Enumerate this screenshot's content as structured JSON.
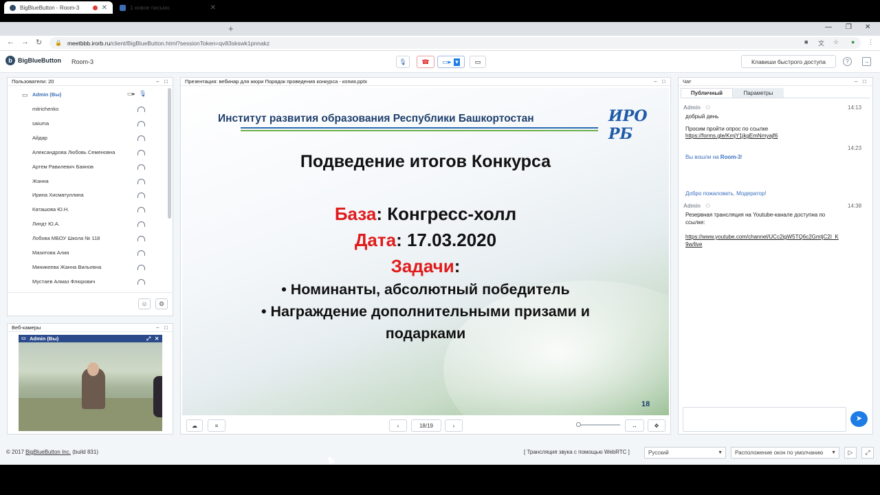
{
  "browser": {
    "tabs": [
      {
        "title": "BigBlueButton - Room-3",
        "active": true
      },
      {
        "title": "1 новое письмо",
        "active": false
      }
    ],
    "url_host": "meetbbb.irorb.ru",
    "url_path": "/client/BigBlueButton.html?sessionToken=qv83skswk1pnnakz"
  },
  "app": {
    "brand": "BigBlueButton",
    "room": "Room-3",
    "hotkeys_label": "Клавиши быстрого доступа"
  },
  "users": {
    "title": "Пользователи: 20",
    "me": "Admin (Вы)",
    "list": [
      "mitrichenko",
      "saiuma",
      "Айдар",
      "Александрова Любовь Семеновна",
      "Артем Равилевич Баянов",
      "Жанна",
      "Ирина Хисматуллина",
      "Каташова Ю.Н.",
      "Линдт Ю.А.",
      "Лобова МБОУ Школа № 118",
      "Мазитова Алия",
      "Миникеева Жанна Вильевна",
      "Мустаев Алмаз Флюрович"
    ]
  },
  "webcams": {
    "title": "Веб-камеры",
    "stream_label": "Admin (Вы)"
  },
  "presentation": {
    "title": "Презентация: вебинар для жюри Порядок проведения конкурса - копия.pptx",
    "page_indicator": "18/19",
    "slide": {
      "header": "Институт развития образования Республики Башкортостан",
      "logo_text": "ИРО РБ",
      "heading": "Подведение итогов Конкурса",
      "base_label": "База",
      "base_value": ": Конгресс-холл",
      "date_label": "Дата",
      "date_value": ": 17.03.2020",
      "tasks_label": "Задачи",
      "tasks_colon": ":",
      "bullet1": "• Номинанты, абсолютный победитель",
      "bullet2": "• Награждение дополнительными призами и",
      "bullet2_cont": "подарками",
      "page_number": "18"
    }
  },
  "chat": {
    "title": "Чат",
    "tab_public": "Публичный",
    "tab_options": "Параметры",
    "messages": {
      "m1_name": "Admin",
      "m1_time": "14:13",
      "m1_l1": "добрый день",
      "m1_l2": "Просим пройти опрос по ссылке",
      "m1_link": "https://forms.gle/KmjY1jkgEmNmyajf6",
      "m2_time": "14:23",
      "m2_text_pre": "Вы вошли на ",
      "m2_text_room": "Room-3",
      "m2_text_post": "!",
      "m3_text": "Добро пожаловать, Модератор!",
      "m4_name": "Admin",
      "m4_time": "14:38",
      "m4_l1": "Резервная трансляция на Youtube-канале доступна по",
      "m4_l2": "ссылке:",
      "m4_link1": "https://www.youtube.com/channel/UCc2igW5TQ6c2GmtjC2I_K",
      "m4_link2": "9w/live"
    }
  },
  "footer": {
    "copyright_pre": "© 2017 ",
    "copyright_link": "BigBlueButton Inc.",
    "copyright_post": " (build 831)",
    "audio": "[ Трансляция звука с помощью WebRTC ]",
    "language": "Русский",
    "layout": "Расположение окон по умолчанию"
  },
  "colors": {
    "accent": "#1e7ce6",
    "danger": "#e01b1b",
    "brand_dark": "#1f3f6e"
  }
}
